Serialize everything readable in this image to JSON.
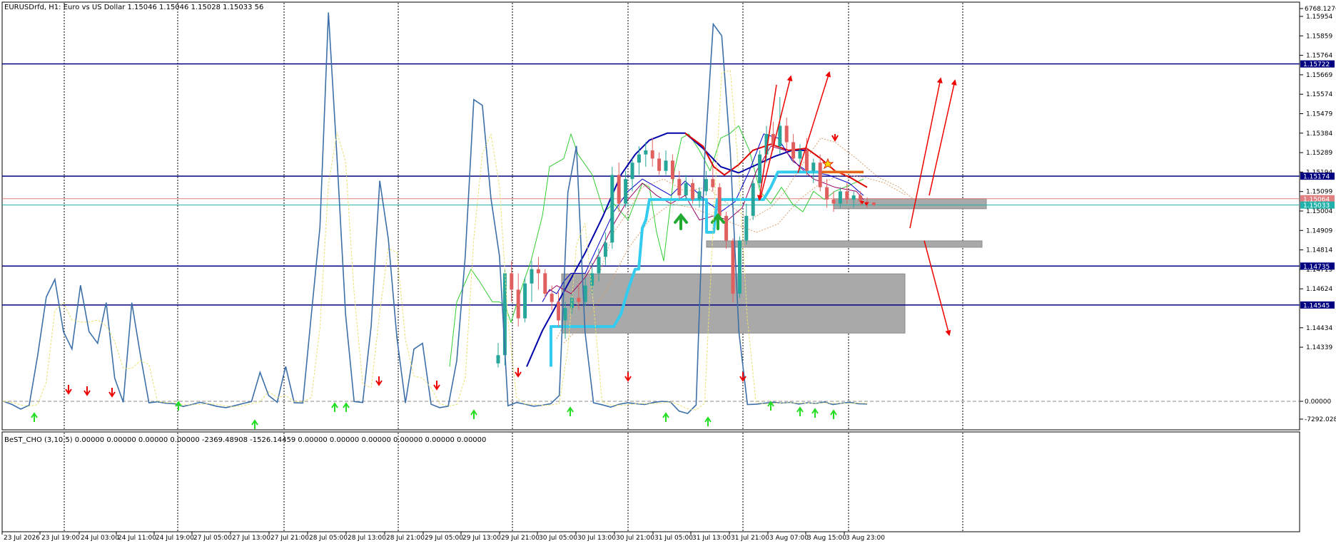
{
  "chart_data": [
    {
      "type": "candlestick",
      "symbol": "EURUSDrfd",
      "timeframe": "H1",
      "title": "EURUSDrfd, H1:  Euro vs US Dollar  1.15046 1.15046 1.15028 1.15033  56",
      "ylim": [
        1.14244,
        1.16026
      ],
      "y_ticks": [
        1.14339,
        1.14434,
        1.14624,
        1.14719,
        1.14814,
        1.14909,
        1.15004,
        1.15099,
        1.15194,
        1.15289,
        1.15384,
        1.15479,
        1.15574,
        1.15669,
        1.15764,
        1.15859,
        1.15954
      ],
      "horizontal_levels": [
        1.15722,
        1.15174,
        1.14735,
        1.14545
      ],
      "price_tags": [
        {
          "value": "1.15722",
          "color": "#000080"
        },
        {
          "value": "1.15174",
          "color": "#000080"
        },
        {
          "value": "1.15064",
          "color": "#e08080"
        },
        {
          "value": "1.15033",
          "color": "#20b2aa"
        },
        {
          "value": "1.14735",
          "color": "#000080"
        },
        {
          "value": "1.14545",
          "color": "#000080"
        }
      ],
      "colors": {
        "bull": "#26a69a",
        "bear": "#e06060",
        "levels": "#000080",
        "ma_dark": "#0000aa",
        "ma_red": "#dd0000",
        "kijun": "#33ccee",
        "span": "#33cc33",
        "arrows": "#ee0000"
      },
      "candles_ohlc": [
        [
          1.1426,
          1.1436,
          1.1424,
          1.143
        ],
        [
          1.143,
          1.1472,
          1.1425,
          1.147
        ],
        [
          1.147,
          1.1476,
          1.1456,
          1.1462
        ],
        [
          1.1462,
          1.147,
          1.1444,
          1.1448
        ],
        [
          1.1448,
          1.1468,
          1.1446,
          1.1465
        ],
        [
          1.1465,
          1.1476,
          1.1456,
          1.1472
        ],
        [
          1.1472,
          1.1478,
          1.1462,
          1.147
        ],
        [
          1.147,
          1.1472,
          1.1458,
          1.146
        ],
        [
          1.146,
          1.1464,
          1.1452,
          1.1456
        ],
        [
          1.1456,
          1.1461,
          1.1444,
          1.1447
        ],
        [
          1.1447,
          1.1456,
          1.1438,
          1.1453
        ],
        [
          1.1453,
          1.146,
          1.145,
          1.1458
        ],
        [
          1.1458,
          1.1465,
          1.1452,
          1.1456
        ],
        [
          1.1456,
          1.1468,
          1.1454,
          1.1464
        ],
        [
          1.1464,
          1.1475,
          1.146,
          1.147
        ],
        [
          1.147,
          1.1482,
          1.1466,
          1.1478
        ],
        [
          1.1478,
          1.149,
          1.1474,
          1.1485
        ],
        [
          1.1485,
          1.1522,
          1.1482,
          1.1518
        ],
        [
          1.1518,
          1.1524,
          1.15,
          1.1504
        ],
        [
          1.1504,
          1.152,
          1.1502,
          1.1516
        ],
        [
          1.1516,
          1.1526,
          1.151,
          1.1524
        ],
        [
          1.1524,
          1.1532,
          1.1518,
          1.1528
        ],
        [
          1.1528,
          1.1534,
          1.1522,
          1.153
        ],
        [
          1.153,
          1.1536,
          1.1522,
          1.1526
        ],
        [
          1.1526,
          1.1529,
          1.1518,
          1.152
        ],
        [
          1.152,
          1.153,
          1.1518,
          1.1525
        ],
        [
          1.1525,
          1.1528,
          1.1514,
          1.1516
        ],
        [
          1.1516,
          1.152,
          1.1506,
          1.1508
        ],
        [
          1.1508,
          1.1518,
          1.1506,
          1.1514
        ],
        [
          1.1514,
          1.1516,
          1.1504,
          1.1506
        ],
        [
          1.1506,
          1.1512,
          1.1502,
          1.151
        ],
        [
          1.151,
          1.152,
          1.1508,
          1.1516
        ],
        [
          1.1516,
          1.1522,
          1.151,
          1.1512
        ],
        [
          1.1512,
          1.1514,
          1.1496,
          1.1498
        ],
        [
          1.1498,
          1.15,
          1.1482,
          1.1486
        ],
        [
          1.1486,
          1.1487,
          1.1456,
          1.146
        ],
        [
          1.146,
          1.1488,
          1.1458,
          1.1486
        ],
        [
          1.1486,
          1.1504,
          1.1484,
          1.1498
        ],
        [
          1.1498,
          1.1516,
          1.1496,
          1.1514
        ],
        [
          1.1514,
          1.153,
          1.1512,
          1.1528
        ],
        [
          1.1528,
          1.1542,
          1.1524,
          1.1538
        ],
        [
          1.1538,
          1.1544,
          1.153,
          1.1532
        ],
        [
          1.1532,
          1.1556,
          1.1528,
          1.1542
        ],
        [
          1.1542,
          1.1546,
          1.153,
          1.1534
        ],
        [
          1.1534,
          1.1538,
          1.1524,
          1.1526
        ],
        [
          1.1526,
          1.1533,
          1.152,
          1.153
        ],
        [
          1.153,
          1.1536,
          1.1518,
          1.152
        ],
        [
          1.152,
          1.1526,
          1.1514,
          1.1524
        ],
        [
          1.1524,
          1.1528,
          1.151,
          1.1512
        ],
        [
          1.1512,
          1.1516,
          1.1502,
          1.1506
        ],
        [
          1.1506,
          1.151,
          1.15,
          1.1504
        ],
        [
          1.1504,
          1.1512,
          1.1502,
          1.151
        ],
        [
          1.151,
          1.1514,
          1.1504,
          1.1506
        ],
        [
          1.1506,
          1.151,
          1.1502,
          1.1508
        ],
        [
          1.1508,
          1.151,
          1.1503,
          1.1505
        ],
        [
          1.1505,
          1.1507,
          1.1502,
          1.1504
        ],
        [
          1.15046,
          1.15046,
          1.15028,
          1.15033
        ]
      ],
      "x_time_labels": [
        "23 Jul 2026",
        "23 Jul 19:00",
        "24 Jul 03:00",
        "24 Jul 11:00",
        "24 Jul 19:00",
        "27 Jul 05:00",
        "27 Jul 13:00",
        "27 Jul 21:00",
        "28 Jul 05:00",
        "28 Jul 13:00",
        "28 Jul 21:00",
        "29 Jul 05:00",
        "29 Jul 13:00",
        "29 Jul 21:00",
        "30 Jul 05:00",
        "30 Jul 13:00",
        "30 Jul 21:00",
        "31 Jul 05:00",
        "31 Jul 13:00",
        "31 Jul 21:00",
        "3 Aug 07:00",
        "3 Aug 15:00",
        "3 Aug 23:00"
      ],
      "zones": [
        {
          "from": 1.14408,
          "to": 1.14697
        },
        {
          "from": 1.14827,
          "to": 1.14858
        },
        {
          "from": 1.15015,
          "to": 1.15064
        }
      ]
    },
    {
      "type": "line",
      "indicator": "BeST_CHO (3,10,5)",
      "values_text": "0.00000 0.00000 0.00000 0.00000 -2369.48908 -1526.14459 0.00000 0.00000 0.00000 0.00000 0.00000 0.00000",
      "y_ticks": [
        "6768.12765",
        "0.00000",
        "-7292.02823"
      ],
      "ylim": [
        -7292.02823,
        6768.12765
      ],
      "series": [
        {
          "values": [
            0,
            -1300,
            -3200,
            -1600,
            800,
            1800,
            2100,
            1200,
            900,
            2000,
            1200,
            1000,
            1700,
            400,
            -400,
            1700,
            800,
            -600,
            -200,
            -800,
            -1000,
            -2100,
            -1300,
            -400,
            -1200,
            -2100,
            -2600,
            -1800,
            -900,
            -100,
            500,
            100,
            -400,
            600,
            -600,
            -700,
            1500,
            3000,
            6700,
            4200,
            1500,
            -100,
            -500,
            1300,
            3800,
            2800,
            1100,
            -700,
            900,
            1000,
            -1200,
            -2600,
            -2000,
            700,
            2500,
            5200,
            5100,
            3500,
            2500,
            -1800,
            -500,
            -1200,
            -2000,
            -1600,
            -1000,
            100,
            3600,
            4400,
            1200,
            -600,
            -1400,
            -2400,
            -1200,
            -600,
            -1000,
            -1300,
            -500,
            0,
            -300,
            -4000,
            -5000,
            -1500,
            4200,
            6500,
            6300,
            4300,
            1200,
            -1300,
            -1200,
            -800,
            -400,
            -700,
            -400,
            -1100,
            -600,
            -900,
            -300,
            -1300,
            -800,
            -400,
            -1000,
            -1100
          ]
        }
      ]
    }
  ],
  "indicator_title": "BeST_CHO (3,10,5)   0.00000 0.00000 0.00000 0.00000 -2369.48908 -1526.14459 0.00000 0.00000 0.00000 0.00000 0.00000 0.00000"
}
